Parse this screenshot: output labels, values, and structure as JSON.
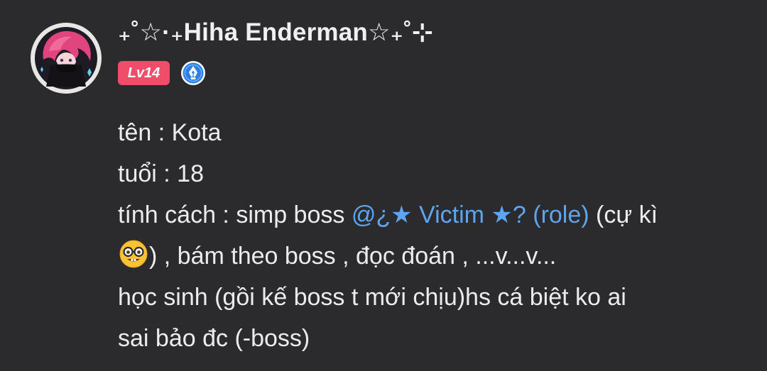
{
  "post": {
    "author": {
      "name": "₊˚☆·₊Hiha Enderman☆₊˚⊹",
      "level": "Lv14",
      "verified_icon": "pen-nib-verified-icon",
      "avatar": "pink-haired-character-avatar"
    },
    "content": {
      "line1": "tên : Kota",
      "line2": "tuổi : 18",
      "line3_prefix": "tính cách : simp boss ",
      "mention": "@¿★ Victim ★? (role)",
      "line3_suffix": " (cự kì",
      "emoji": "nerd-face-emoji",
      "line4_text": ") , bám theo boss , đọc đoán , ...v...v...",
      "line5": "học sinh (gồi kế boss t mới chịu)hs cá biệt ko ai",
      "line6": "sai bảo đc (-boss)"
    }
  },
  "colors": {
    "background": "#2b2b2d",
    "text": "#ececee",
    "mention": "#5ea4f0",
    "level_badge": "#f04d6b",
    "verify_badge": "#2f7ee6"
  }
}
